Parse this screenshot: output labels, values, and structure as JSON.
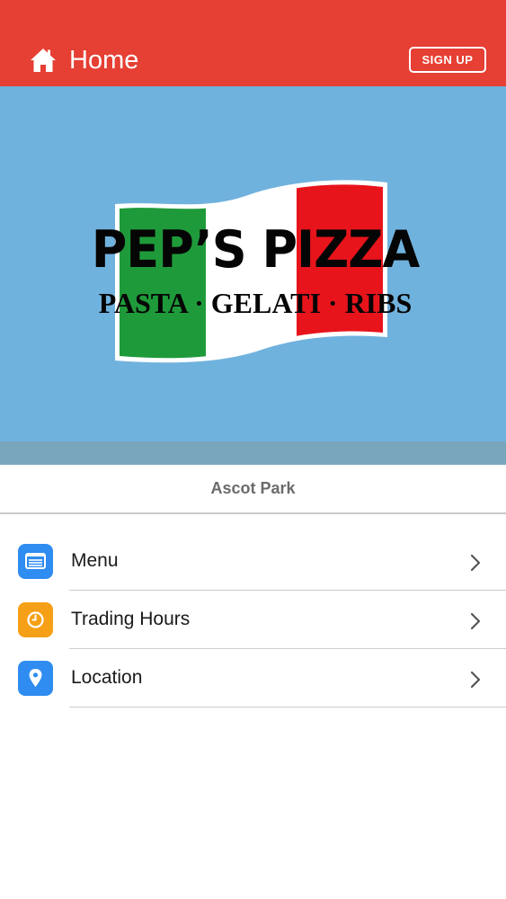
{
  "header": {
    "title": "Home",
    "signup_label": "SIGN UP",
    "background_color": "#e63f33",
    "home_icon": "home-icon"
  },
  "hero": {
    "background_color": "#70b2de",
    "logo_title": "PEP’S PIZZA",
    "logo_subtitle": "PASTA · GELATI · RIBS"
  },
  "location": {
    "name": "Ascot Park"
  },
  "menu_items": [
    {
      "label": "Menu",
      "icon": "menu-list-icon",
      "color": "#2f8cf0"
    },
    {
      "label": "Trading Hours",
      "icon": "clock-icon",
      "color": "#f5a016"
    },
    {
      "label": "Location",
      "icon": "map-pin-icon",
      "color": "#2f8cf0"
    }
  ]
}
